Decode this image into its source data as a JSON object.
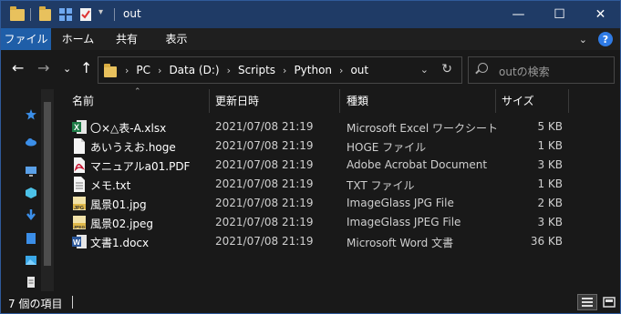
{
  "window": {
    "title": "out",
    "controls": {
      "minimize": "—",
      "maximize": "☐",
      "close": "✕"
    }
  },
  "ribbon": {
    "tabs": [
      {
        "label": "ファイル",
        "active": true
      },
      {
        "label": "ホーム"
      },
      {
        "label": "共有"
      },
      {
        "label": "表示"
      }
    ],
    "collapse_glyph": "⌄",
    "help_glyph": "?"
  },
  "navigation": {
    "back": "←",
    "forward": "→",
    "recent": "⌄",
    "up": "↑"
  },
  "address": {
    "crumbs": [
      "PC",
      "Data (D:)",
      "Scripts",
      "Python",
      "out"
    ],
    "separator": "›",
    "dropdown": "⌄",
    "refresh": "↻"
  },
  "search": {
    "placeholder": "outの検索"
  },
  "columns": {
    "name": "名前",
    "date": "更新日時",
    "type": "種類",
    "size": "サイズ"
  },
  "files": [
    {
      "icon": "excel-icon",
      "name": "〇×△表-A.xlsx",
      "date": "2021/07/08 21:19",
      "type": "Microsoft Excel ワークシート",
      "size": "5 KB"
    },
    {
      "icon": "blank-file-icon",
      "name": "あいうえお.hoge",
      "date": "2021/07/08 21:19",
      "type": "HOGE ファイル",
      "size": "1 KB"
    },
    {
      "icon": "pdf-icon",
      "name": "マニュアルa01.PDF",
      "date": "2021/07/08 21:19",
      "type": "Adobe Acrobat Document",
      "size": "3 KB"
    },
    {
      "icon": "text-file-icon",
      "name": "メモ.txt",
      "date": "2021/07/08 21:19",
      "type": "TXT ファイル",
      "size": "1 KB"
    },
    {
      "icon": "jpg-icon",
      "name": "風景01.jpg",
      "date": "2021/07/08 21:19",
      "type": "ImageGlass JPG File",
      "size": "2 KB"
    },
    {
      "icon": "jpeg-icon",
      "name": "風景02.jpeg",
      "date": "2021/07/08 21:19",
      "type": "ImageGlass JPEG File",
      "size": "3 KB"
    },
    {
      "icon": "word-icon",
      "name": "文書1.docx",
      "date": "2021/07/08 21:19",
      "type": "Microsoft Word 文書",
      "size": "36 KB"
    }
  ],
  "status": {
    "item_count": "7 個の項目"
  },
  "colors": {
    "titlebar": "#1f3b66",
    "accent": "#1f5ea8",
    "background": "#191919",
    "excel": "#1d7a45",
    "word": "#2b579a",
    "pdf": "#c8102e"
  }
}
